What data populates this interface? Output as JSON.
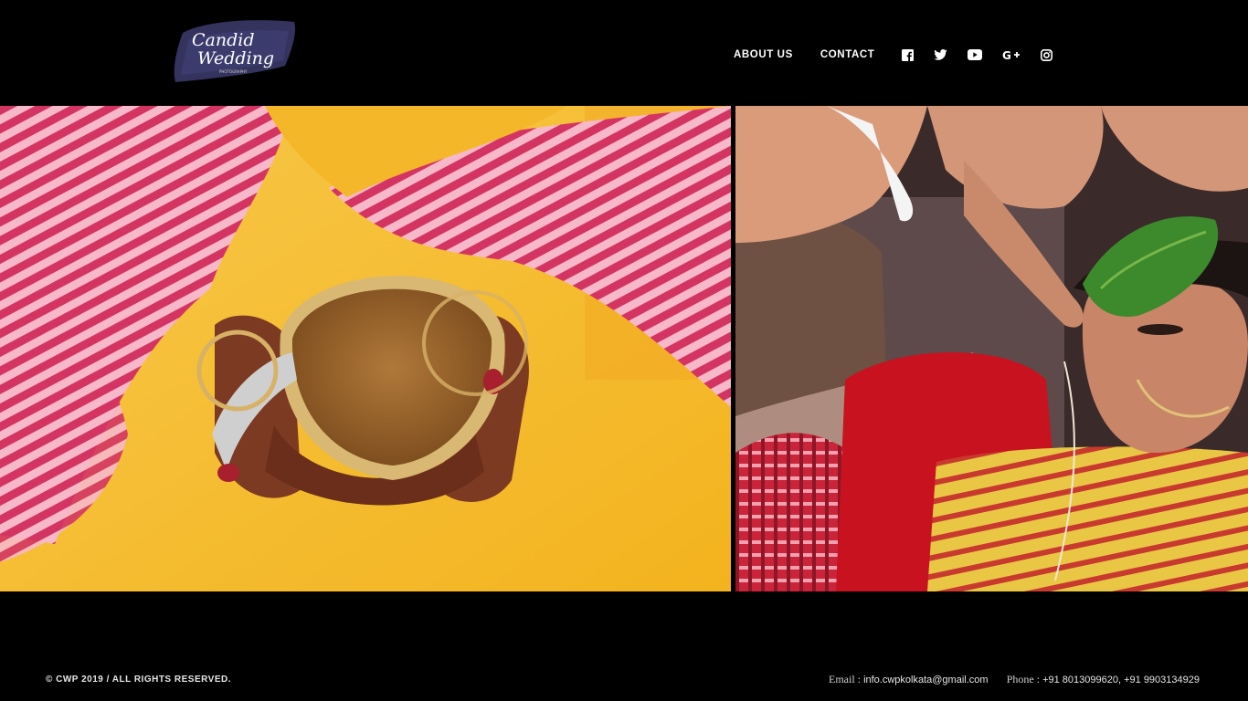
{
  "header": {
    "logo": {
      "line1": "Candid",
      "line2": "Wedding",
      "tagline": "PHOTOGRAPHY"
    },
    "nav": {
      "about_label": "ABOUT US",
      "contact_label": "CONTACT"
    },
    "social": [
      "facebook-icon",
      "twitter-icon",
      "youtube-icon",
      "google-plus-icon",
      "instagram-icon"
    ]
  },
  "gallery": {
    "left_photo": "haldi-bowl-photo",
    "right_photo": "bride-betel-leaf-photo"
  },
  "footer": {
    "copyright": "© CWP 2019 / ALL RIGHTS RESERVED.",
    "email_label": "Email :",
    "email": "info.cwpkolkata@gmail.com",
    "phone_label": "Phone :",
    "phone": "+91 8013099620, +91 9903134929"
  },
  "colors": {
    "background": "#000000",
    "text": "#ffffff",
    "logo_brush": "#3b3a66"
  }
}
